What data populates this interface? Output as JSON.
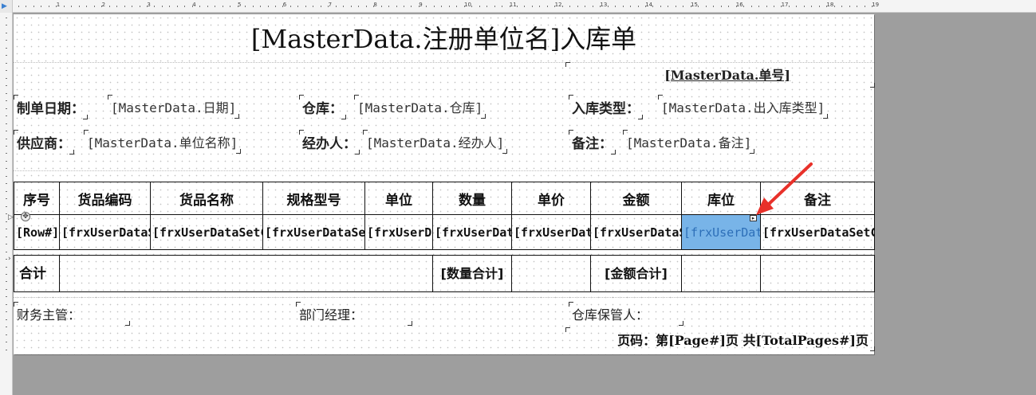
{
  "ruler": {
    "marks": [
      "1",
      "2",
      "3",
      "4",
      "5",
      "6",
      "7",
      "8",
      "9",
      "10",
      "11",
      "12",
      "13",
      "14",
      "15",
      "16",
      "17",
      "18",
      "19"
    ]
  },
  "title": "[MasterData.注册单位名]入库单",
  "header": {
    "order_no": "[MasterData.单号]",
    "date_label": "制单日期：",
    "date_value": "[MasterData.日期]",
    "warehouse_label": "仓库：",
    "warehouse_value": "[MasterData.仓库]",
    "in_type_label": "入库类型：",
    "in_type_value": "[MasterData.出入库类型]",
    "supplier_label": "供应商：",
    "supplier_value": "[MasterData.单位名称]",
    "handler_label": "经办人：",
    "handler_value": "[MasterData.经办人]",
    "remark_label": "备注：",
    "remark_value": "[MasterData.备注]"
  },
  "table": {
    "columns": [
      "序号",
      "货品编码",
      "货品名称",
      "规格型号",
      "单位",
      "数量",
      "单价",
      "金额",
      "库位",
      "备注"
    ],
    "row": [
      "[Row#]",
      "[frxUserDataSetCrk",
      "[frxUserDataSetCrk.货品",
      "[frxUserDataSetCrk.规",
      "[frxUserData",
      "[frxUserDataSetC",
      "[frxUserDataSetC",
      "[frxUserDataSetCrk",
      "[frxUserDataSetCrk",
      "[frxUserDataSetCrk.备注]"
    ],
    "total_label": "合计",
    "qty_total": "[数量合计]",
    "amount_total": "[金额合计]"
  },
  "footer": {
    "finance_label": "财务主管：",
    "manager_label": "部门经理：",
    "keeper_label": "仓库保管人：",
    "page_text": "页码：第[Page#]页 共[TotalPages#]页"
  },
  "colors": {
    "selection": "#78b4e8",
    "arrow": "#e8312a",
    "workspace": "#9e9e9e"
  },
  "icons": {
    "selection_handle": "triangle-right",
    "move_handle": "cross-arrows",
    "annotation": "red-arrow"
  }
}
